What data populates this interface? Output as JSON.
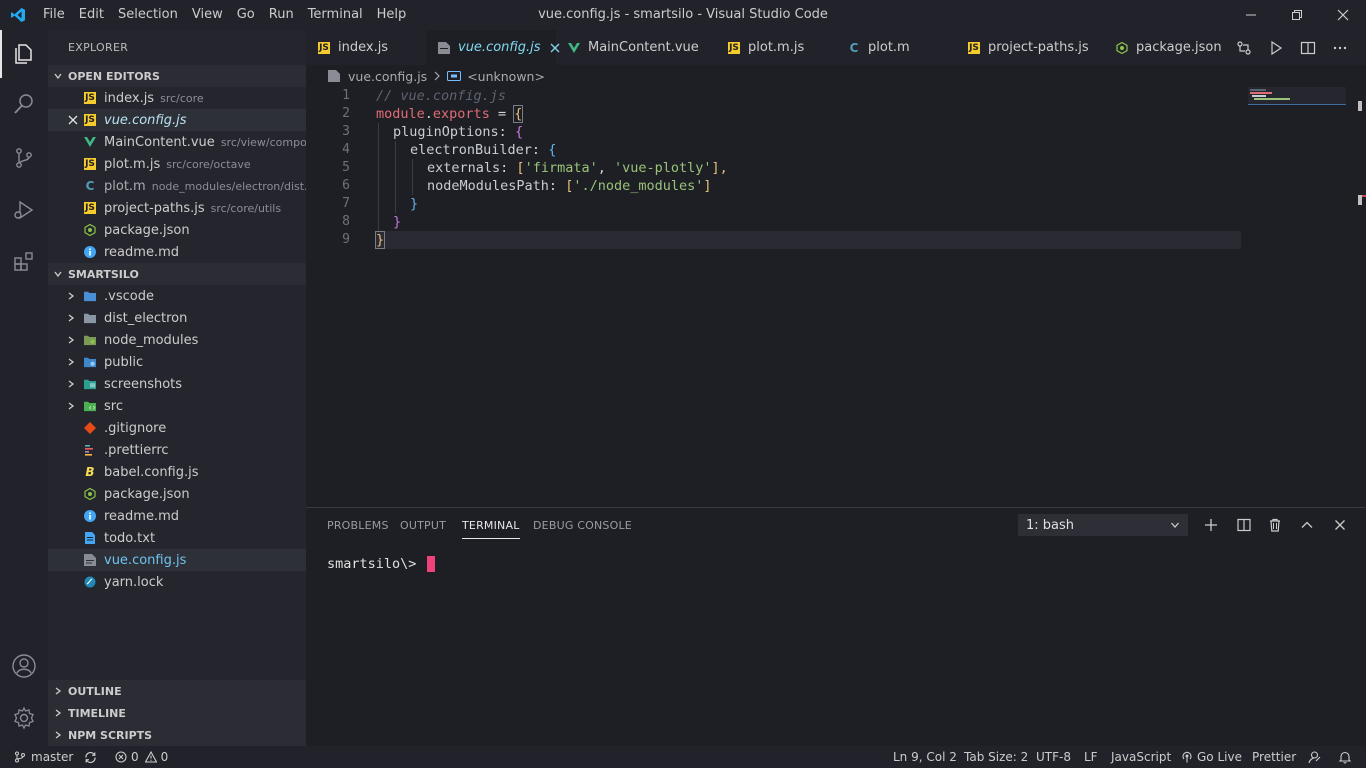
{
  "titlebar": {
    "menu": [
      "File",
      "Edit",
      "Selection",
      "View",
      "Go",
      "Run",
      "Terminal",
      "Help"
    ],
    "title": "vue.config.js - smartsilo - Visual Studio Code",
    "accent": "#23a9f2"
  },
  "sidebar": {
    "title": "EXPLORER",
    "open_editors_title": "OPEN EDITORS",
    "open_editors": [
      {
        "name": "index.js",
        "path": "src/core"
      },
      {
        "name": "vue.config.js",
        "path": ""
      },
      {
        "name": "MainContent.vue",
        "path": "src/view/compo..."
      },
      {
        "name": "plot.m.js",
        "path": "src/core/octave"
      },
      {
        "name": "plot.m",
        "path": "node_modules/electron/dist..."
      },
      {
        "name": "project-paths.js",
        "path": "src/core/utils"
      },
      {
        "name": "package.json",
        "path": ""
      },
      {
        "name": "readme.md",
        "path": ""
      }
    ],
    "project_title": "SMARTSILO",
    "folders": [
      ".vscode",
      "dist_electron",
      "node_modules",
      "public",
      "screenshots",
      "src"
    ],
    "files": [
      ".gitignore",
      ".prettierrc",
      "babel.config.js",
      "package.json",
      "readme.md",
      "todo.txt",
      "vue.config.js",
      "yarn.lock"
    ],
    "outline": "OUTLINE",
    "timeline": "TIMELINE",
    "npm_scripts": "NPM SCRIPTS"
  },
  "tabs": [
    {
      "label": "index.js"
    },
    {
      "label": "vue.config.js"
    },
    {
      "label": "MainContent.vue"
    },
    {
      "label": "plot.m.js"
    },
    {
      "label": "plot.m"
    },
    {
      "label": "project-paths.js"
    },
    {
      "label": "package.json"
    }
  ],
  "breadcrumb": {
    "file": "vue.config.js",
    "symbol": "<unknown>"
  },
  "editor": {
    "line_numbers": [
      "1",
      "2",
      "3",
      "4",
      "5",
      "6",
      "7",
      "8",
      "9"
    ],
    "l1_comment": "// vue.config.js",
    "l2_module": "module",
    "l2_dot": ".",
    "l2_exports": "exports",
    "l2_eq": " = ",
    "l2_brace": "{",
    "l3_key": "pluginOptions",
    "l3_colon": ": ",
    "l3_brace": "{",
    "l4_key": "electronBuilder",
    "l4_colon": ": ",
    "l4_brace": "{",
    "l5_key": "externals",
    "l5_colon": ": ",
    "l5_open": "[",
    "l5_s1": "'firmata'",
    "l5_comma": ", ",
    "l5_s2": "'vue-plotly'",
    "l5_close": "],",
    "l6_key": "nodeModulesPath",
    "l6_colon": ": ",
    "l6_open": "[",
    "l6_s1": "'./node_modules'",
    "l6_close": "]",
    "l7_brace": "}",
    "l8_brace": "}",
    "l9_brace": "}"
  },
  "panel": {
    "tabs": [
      "PROBLEMS",
      "OUTPUT",
      "TERMINAL",
      "DEBUG CONSOLE"
    ],
    "active_tab": "TERMINAL",
    "terminal_select": "1: bash",
    "prompt": "smartsilo\\> "
  },
  "statusbar": {
    "branch": "master",
    "errors": "0",
    "warnings": "0",
    "position": "Ln 9, Col 2",
    "tab_size": "Tab Size: 2",
    "encoding": "UTF-8",
    "eol": "LF",
    "language": "JavaScript",
    "go_live": "Go Live",
    "prettier": "Prettier"
  }
}
